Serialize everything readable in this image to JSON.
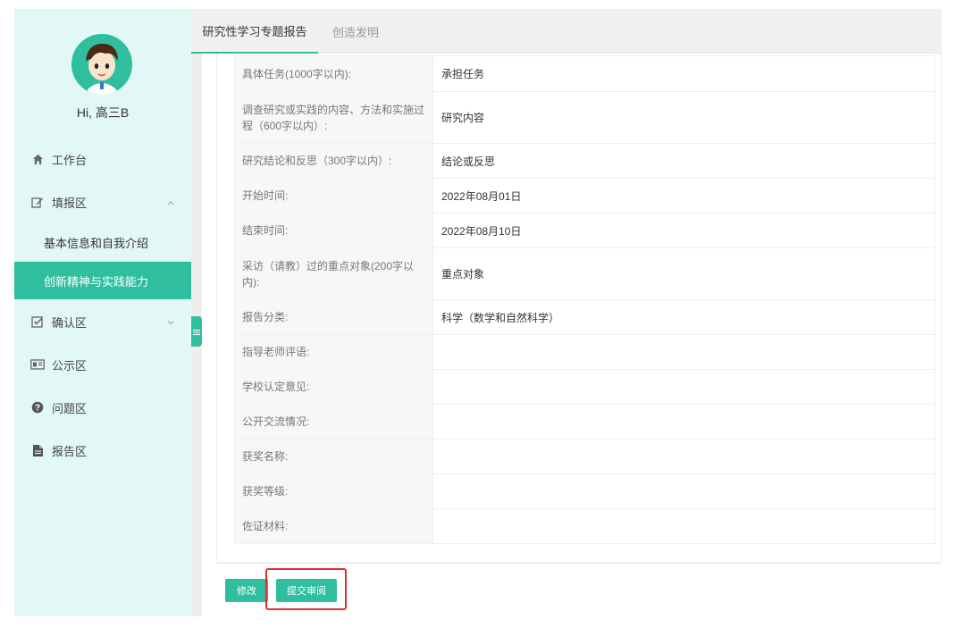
{
  "user": {
    "greeting": "Hi, 高三B"
  },
  "sidebar": {
    "workbench": "工作台",
    "fill_section": "填报区",
    "fill_sub": [
      "基本信息和自我介绍",
      "创新精神与实践能力"
    ],
    "confirm_section": "确认区",
    "public_section": "公示区",
    "question_section": "问题区",
    "report_section": "报告区"
  },
  "tabs": [
    {
      "label": "研究性学习专题报告"
    },
    {
      "label": "创造发明"
    }
  ],
  "rows": [
    {
      "label": "具体任务(1000字以内):",
      "value": "承担任务"
    },
    {
      "label": "调查研究或实践的内容、方法和实施过程（600字以内）:",
      "value": "研究内容"
    },
    {
      "label": "研究结论和反思（300字以内）:",
      "value": "结论或反思"
    },
    {
      "label": "开始时间:",
      "value": "2022年08月01日"
    },
    {
      "label": "结束时间:",
      "value": "2022年08月10日"
    },
    {
      "label": "采访（请教）过的重点对象(200字以内):",
      "value": "重点对象"
    },
    {
      "label": "报告分类:",
      "value": "科学（数学和自然科学）"
    },
    {
      "label": "指导老师评语:",
      "value": ""
    },
    {
      "label": "学校认定意见:",
      "value": ""
    },
    {
      "label": "公开交流情况:",
      "value": ""
    },
    {
      "label": "获奖名称:",
      "value": ""
    },
    {
      "label": "获奖等级:",
      "value": ""
    },
    {
      "label": "佐证材料:",
      "value": ""
    }
  ],
  "actions": {
    "edit": "修改",
    "submit": "提交审阅"
  },
  "colors": {
    "accent": "#2fbf9f",
    "highlight": "#e0312f",
    "sidebar_bg": "#e2f8f6"
  },
  "icons": [
    "avatar",
    "home-icon",
    "edit-icon",
    "chevron-up-icon",
    "check-square-icon",
    "chevron-down-icon",
    "id-card-icon",
    "question-circle-icon",
    "file-icon",
    "menu-lines-icon"
  ]
}
